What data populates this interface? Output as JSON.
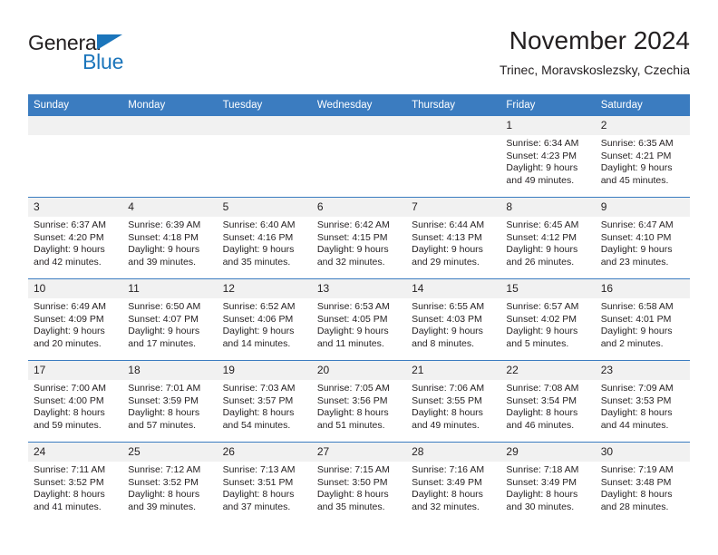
{
  "brand": {
    "name_top": "General",
    "name_bottom": "Blue",
    "flag_icon": "blue-triangle-flag-icon",
    "accent_color": "#1b75bb"
  },
  "header": {
    "title": "November 2024",
    "subtitle": "Trinec, Moravskoslezsky, Czechia"
  },
  "theme": {
    "header_blue": "#3b7cc0",
    "daynum_gray": "#f1f1f1",
    "text": "#231f20"
  },
  "calendar": {
    "weekday_headers": [
      "Sunday",
      "Monday",
      "Tuesday",
      "Wednesday",
      "Thursday",
      "Friday",
      "Saturday"
    ],
    "weeks": [
      [
        {
          "day": "",
          "sunrise": "",
          "sunset": "",
          "daylight_line1": "",
          "daylight_line2": "",
          "empty": true
        },
        {
          "day": "",
          "sunrise": "",
          "sunset": "",
          "daylight_line1": "",
          "daylight_line2": "",
          "empty": true
        },
        {
          "day": "",
          "sunrise": "",
          "sunset": "",
          "daylight_line1": "",
          "daylight_line2": "",
          "empty": true
        },
        {
          "day": "",
          "sunrise": "",
          "sunset": "",
          "daylight_line1": "",
          "daylight_line2": "",
          "empty": true
        },
        {
          "day": "",
          "sunrise": "",
          "sunset": "",
          "daylight_line1": "",
          "daylight_line2": "",
          "empty": true
        },
        {
          "day": "1",
          "sunrise": "Sunrise: 6:34 AM",
          "sunset": "Sunset: 4:23 PM",
          "daylight_line1": "Daylight: 9 hours",
          "daylight_line2": "and 49 minutes.",
          "empty": false
        },
        {
          "day": "2",
          "sunrise": "Sunrise: 6:35 AM",
          "sunset": "Sunset: 4:21 PM",
          "daylight_line1": "Daylight: 9 hours",
          "daylight_line2": "and 45 minutes.",
          "empty": false
        }
      ],
      [
        {
          "day": "3",
          "sunrise": "Sunrise: 6:37 AM",
          "sunset": "Sunset: 4:20 PM",
          "daylight_line1": "Daylight: 9 hours",
          "daylight_line2": "and 42 minutes.",
          "empty": false
        },
        {
          "day": "4",
          "sunrise": "Sunrise: 6:39 AM",
          "sunset": "Sunset: 4:18 PM",
          "daylight_line1": "Daylight: 9 hours",
          "daylight_line2": "and 39 minutes.",
          "empty": false
        },
        {
          "day": "5",
          "sunrise": "Sunrise: 6:40 AM",
          "sunset": "Sunset: 4:16 PM",
          "daylight_line1": "Daylight: 9 hours",
          "daylight_line2": "and 35 minutes.",
          "empty": false
        },
        {
          "day": "6",
          "sunrise": "Sunrise: 6:42 AM",
          "sunset": "Sunset: 4:15 PM",
          "daylight_line1": "Daylight: 9 hours",
          "daylight_line2": "and 32 minutes.",
          "empty": false
        },
        {
          "day": "7",
          "sunrise": "Sunrise: 6:44 AM",
          "sunset": "Sunset: 4:13 PM",
          "daylight_line1": "Daylight: 9 hours",
          "daylight_line2": "and 29 minutes.",
          "empty": false
        },
        {
          "day": "8",
          "sunrise": "Sunrise: 6:45 AM",
          "sunset": "Sunset: 4:12 PM",
          "daylight_line1": "Daylight: 9 hours",
          "daylight_line2": "and 26 minutes.",
          "empty": false
        },
        {
          "day": "9",
          "sunrise": "Sunrise: 6:47 AM",
          "sunset": "Sunset: 4:10 PM",
          "daylight_line1": "Daylight: 9 hours",
          "daylight_line2": "and 23 minutes.",
          "empty": false
        }
      ],
      [
        {
          "day": "10",
          "sunrise": "Sunrise: 6:49 AM",
          "sunset": "Sunset: 4:09 PM",
          "daylight_line1": "Daylight: 9 hours",
          "daylight_line2": "and 20 minutes.",
          "empty": false
        },
        {
          "day": "11",
          "sunrise": "Sunrise: 6:50 AM",
          "sunset": "Sunset: 4:07 PM",
          "daylight_line1": "Daylight: 9 hours",
          "daylight_line2": "and 17 minutes.",
          "empty": false
        },
        {
          "day": "12",
          "sunrise": "Sunrise: 6:52 AM",
          "sunset": "Sunset: 4:06 PM",
          "daylight_line1": "Daylight: 9 hours",
          "daylight_line2": "and 14 minutes.",
          "empty": false
        },
        {
          "day": "13",
          "sunrise": "Sunrise: 6:53 AM",
          "sunset": "Sunset: 4:05 PM",
          "daylight_line1": "Daylight: 9 hours",
          "daylight_line2": "and 11 minutes.",
          "empty": false
        },
        {
          "day": "14",
          "sunrise": "Sunrise: 6:55 AM",
          "sunset": "Sunset: 4:03 PM",
          "daylight_line1": "Daylight: 9 hours",
          "daylight_line2": "and 8 minutes.",
          "empty": false
        },
        {
          "day": "15",
          "sunrise": "Sunrise: 6:57 AM",
          "sunset": "Sunset: 4:02 PM",
          "daylight_line1": "Daylight: 9 hours",
          "daylight_line2": "and 5 minutes.",
          "empty": false
        },
        {
          "day": "16",
          "sunrise": "Sunrise: 6:58 AM",
          "sunset": "Sunset: 4:01 PM",
          "daylight_line1": "Daylight: 9 hours",
          "daylight_line2": "and 2 minutes.",
          "empty": false
        }
      ],
      [
        {
          "day": "17",
          "sunrise": "Sunrise: 7:00 AM",
          "sunset": "Sunset: 4:00 PM",
          "daylight_line1": "Daylight: 8 hours",
          "daylight_line2": "and 59 minutes.",
          "empty": false
        },
        {
          "day": "18",
          "sunrise": "Sunrise: 7:01 AM",
          "sunset": "Sunset: 3:59 PM",
          "daylight_line1": "Daylight: 8 hours",
          "daylight_line2": "and 57 minutes.",
          "empty": false
        },
        {
          "day": "19",
          "sunrise": "Sunrise: 7:03 AM",
          "sunset": "Sunset: 3:57 PM",
          "daylight_line1": "Daylight: 8 hours",
          "daylight_line2": "and 54 minutes.",
          "empty": false
        },
        {
          "day": "20",
          "sunrise": "Sunrise: 7:05 AM",
          "sunset": "Sunset: 3:56 PM",
          "daylight_line1": "Daylight: 8 hours",
          "daylight_line2": "and 51 minutes.",
          "empty": false
        },
        {
          "day": "21",
          "sunrise": "Sunrise: 7:06 AM",
          "sunset": "Sunset: 3:55 PM",
          "daylight_line1": "Daylight: 8 hours",
          "daylight_line2": "and 49 minutes.",
          "empty": false
        },
        {
          "day": "22",
          "sunrise": "Sunrise: 7:08 AM",
          "sunset": "Sunset: 3:54 PM",
          "daylight_line1": "Daylight: 8 hours",
          "daylight_line2": "and 46 minutes.",
          "empty": false
        },
        {
          "day": "23",
          "sunrise": "Sunrise: 7:09 AM",
          "sunset": "Sunset: 3:53 PM",
          "daylight_line1": "Daylight: 8 hours",
          "daylight_line2": "and 44 minutes.",
          "empty": false
        }
      ],
      [
        {
          "day": "24",
          "sunrise": "Sunrise: 7:11 AM",
          "sunset": "Sunset: 3:52 PM",
          "daylight_line1": "Daylight: 8 hours",
          "daylight_line2": "and 41 minutes.",
          "empty": false
        },
        {
          "day": "25",
          "sunrise": "Sunrise: 7:12 AM",
          "sunset": "Sunset: 3:52 PM",
          "daylight_line1": "Daylight: 8 hours",
          "daylight_line2": "and 39 minutes.",
          "empty": false
        },
        {
          "day": "26",
          "sunrise": "Sunrise: 7:13 AM",
          "sunset": "Sunset: 3:51 PM",
          "daylight_line1": "Daylight: 8 hours",
          "daylight_line2": "and 37 minutes.",
          "empty": false
        },
        {
          "day": "27",
          "sunrise": "Sunrise: 7:15 AM",
          "sunset": "Sunset: 3:50 PM",
          "daylight_line1": "Daylight: 8 hours",
          "daylight_line2": "and 35 minutes.",
          "empty": false
        },
        {
          "day": "28",
          "sunrise": "Sunrise: 7:16 AM",
          "sunset": "Sunset: 3:49 PM",
          "daylight_line1": "Daylight: 8 hours",
          "daylight_line2": "and 32 minutes.",
          "empty": false
        },
        {
          "day": "29",
          "sunrise": "Sunrise: 7:18 AM",
          "sunset": "Sunset: 3:49 PM",
          "daylight_line1": "Daylight: 8 hours",
          "daylight_line2": "and 30 minutes.",
          "empty": false
        },
        {
          "day": "30",
          "sunrise": "Sunrise: 7:19 AM",
          "sunset": "Sunset: 3:48 PM",
          "daylight_line1": "Daylight: 8 hours",
          "daylight_line2": "and 28 minutes.",
          "empty": false
        }
      ]
    ]
  }
}
